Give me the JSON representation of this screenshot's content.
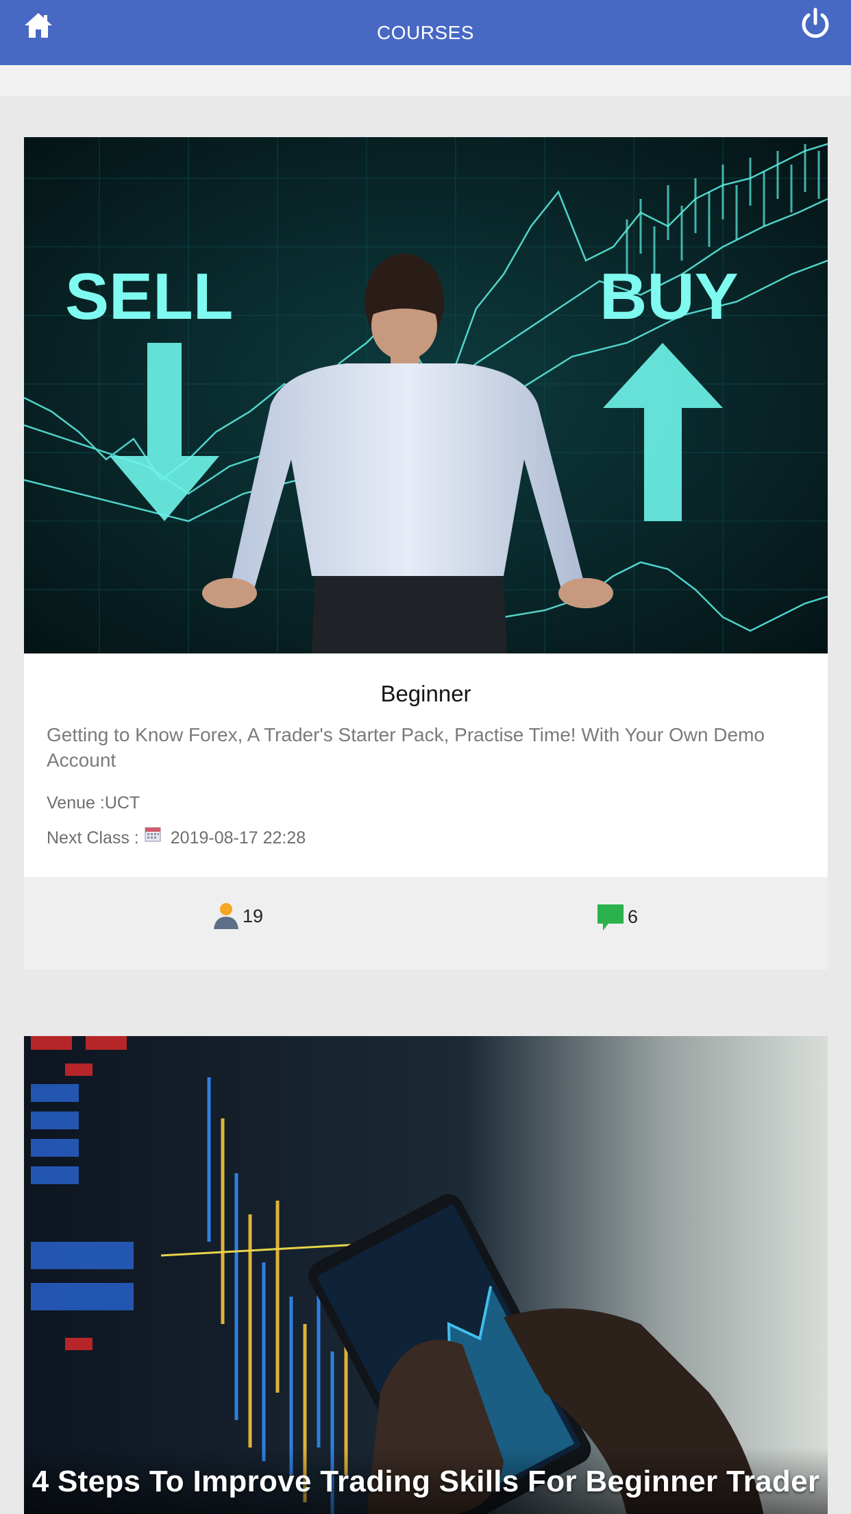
{
  "header": {
    "title": "COURSES",
    "home_icon": "home-icon",
    "power_icon": "power-icon",
    "color": "#4769c4"
  },
  "courses": [
    {
      "image_labels": {
        "sell": "SELL",
        "buy": "BUY"
      },
      "title": "Beginner",
      "description": "Getting to Know Forex, A Trader's Starter Pack, Practise Time! With Your Own Demo Account",
      "venue_label": "Venue : ",
      "venue": "UCT",
      "next_class_label": "Next Class : ",
      "next_class": "2019-08-17 22:28",
      "students": "19",
      "comments": "6"
    },
    {
      "caption": "4 Steps To Improve Trading Skills For Beginner Trader"
    }
  ],
  "colors": {
    "chart_teal": "#5ef2e6",
    "users_icon": "#f5a623",
    "comments_icon": "#2bb24c"
  }
}
